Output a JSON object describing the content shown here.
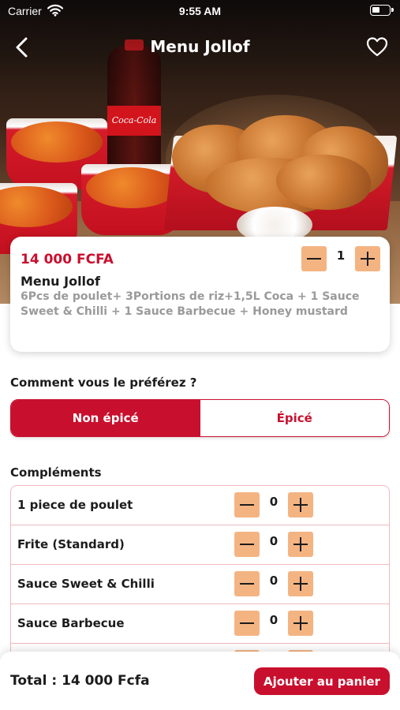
{
  "status_bar": {
    "carrier": "Carrier",
    "time": "9:55 AM",
    "icons": [
      "wifi-icon",
      "battery-icon"
    ]
  },
  "nav": {
    "title": "Menu Jollof",
    "back_icon": "chevron-left-icon",
    "favorite_icon": "heart-icon"
  },
  "hero": {
    "bottle_label": "Coca-Cola"
  },
  "product": {
    "price": "14 000 FCFA",
    "name": "Menu Jollof",
    "description": "6Pcs de poulet+ 3Portions de riz+1,5L Coca + 1 Sauce Sweet & Chilli + 1 Sauce Barbecue + Honey mustard",
    "quantity": "1"
  },
  "preference": {
    "label": "Comment vous le préférez ?",
    "options": [
      "Non épicé",
      "Épicé"
    ],
    "selected": "Non épicé"
  },
  "complements": {
    "label": "Compléments",
    "items": [
      {
        "name": "1 piece de poulet",
        "quantity": "0"
      },
      {
        "name": "Frite (Standard)",
        "quantity": "0"
      },
      {
        "name": "Sauce Sweet & Chilli",
        "quantity": "0"
      },
      {
        "name": "Sauce Barbecue",
        "quantity": "0"
      },
      {
        "name": "",
        "quantity": ""
      }
    ]
  },
  "footer": {
    "total": "Total : 14 000 Fcfa",
    "cart_button": "Ajouter au panier"
  },
  "colors": {
    "accent": "#c8102e",
    "stepper": "#f4b482",
    "description_text": "#9a9a9a"
  }
}
